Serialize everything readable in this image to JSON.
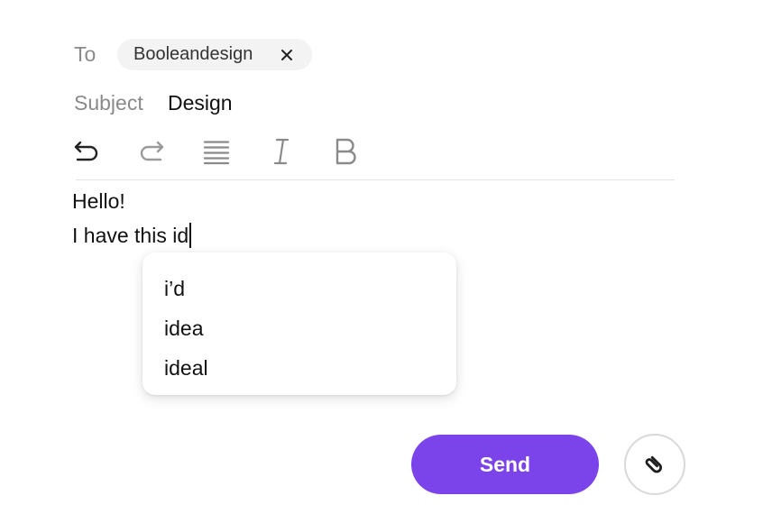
{
  "header": {
    "to_label": "To",
    "recipient": "Booleandesign",
    "subject_label": "Subject",
    "subject_value": "Design"
  },
  "toolbar": {
    "items": [
      {
        "name": "undo",
        "icon": "undo-icon",
        "enabled": true
      },
      {
        "name": "redo",
        "icon": "redo-icon",
        "enabled": false
      },
      {
        "name": "align",
        "icon": "align-justify-icon",
        "enabled": true
      },
      {
        "name": "italic",
        "icon": "italic-icon",
        "enabled": true
      },
      {
        "name": "bold",
        "icon": "bold-icon",
        "enabled": true
      }
    ]
  },
  "body": {
    "lines": [
      "Hello!",
      "I have this id"
    ]
  },
  "suggestions": [
    "i’d",
    "idea",
    "ideal"
  ],
  "actions": {
    "send_label": "Send",
    "attach_icon": "paperclip-icon"
  },
  "colors": {
    "accent": "#7b44ea",
    "muted_text": "#8a8a8a",
    "chip_bg": "#f3f3f3"
  }
}
